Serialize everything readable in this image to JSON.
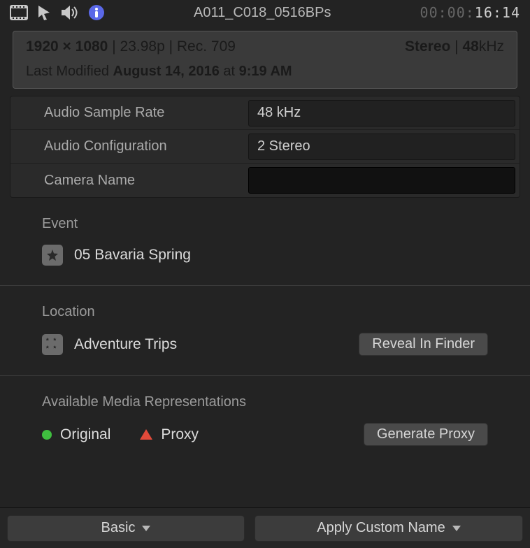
{
  "header": {
    "clip_name": "A011_C018_0516BPs",
    "timecode_dim": "00:00:",
    "timecode_live": "16:14"
  },
  "summary": {
    "resolution": "1920 × 1080",
    "frame_rate": "23.98p",
    "color_space": "Rec. 709",
    "audio_channels": "Stereo",
    "audio_rate_label": "48",
    "audio_rate_unit": "kHz",
    "last_modified_prefix": "Last Modified",
    "last_modified_date": "August 14, 2016",
    "last_modified_at": "at",
    "last_modified_time": "9:19 AM"
  },
  "props": {
    "audio_sample_rate": {
      "label": "Audio Sample Rate",
      "value": "48 kHz"
    },
    "audio_configuration": {
      "label": "Audio Configuration",
      "value": "2 Stereo"
    },
    "camera_name": {
      "label": "Camera Name",
      "value": ""
    }
  },
  "event": {
    "label": "Event",
    "name": "05 Bavaria Spring"
  },
  "location": {
    "label": "Location",
    "name": "Adventure Trips",
    "reveal_button": "Reveal In Finder"
  },
  "media": {
    "label": "Available Media Representations",
    "original_label": "Original",
    "proxy_label": "Proxy",
    "generate_button": "Generate Proxy"
  },
  "bottombar": {
    "left_dropdown": "Basic",
    "right_dropdown": "Apply Custom Name"
  }
}
